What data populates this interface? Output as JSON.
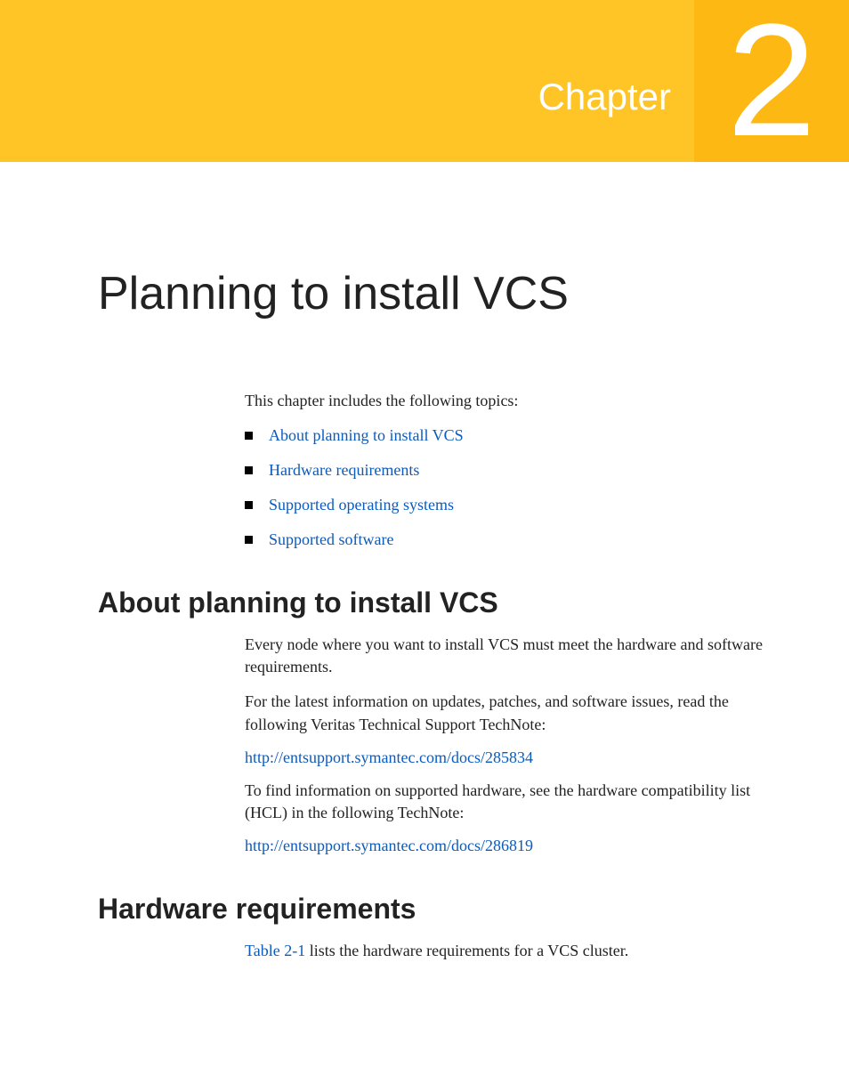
{
  "header": {
    "chapter_label": "Chapter",
    "chapter_number": "2"
  },
  "page_title": "Planning to install VCS",
  "intro": "This chapter includes the following topics:",
  "topics": [
    "About planning to install VCS",
    "Hardware requirements",
    "Supported operating systems",
    "Supported software"
  ],
  "sections": {
    "about": {
      "heading": "About planning to install VCS",
      "p1": "Every node where you want to install VCS must meet the hardware and software requirements.",
      "p2": "For the latest information on updates, patches, and software issues, read the following Veritas Technical Support TechNote:",
      "link1": "http://entsupport.symantec.com/docs/285834",
      "p3": "To find information on supported hardware, see the hardware compatibility list (HCL) in the following TechNote:",
      "link2": "http://entsupport.symantec.com/docs/286819"
    },
    "hardware": {
      "heading": "Hardware requirements",
      "table_ref": "Table 2-1",
      "p1_rest": " lists the hardware requirements for a VCS cluster."
    }
  }
}
